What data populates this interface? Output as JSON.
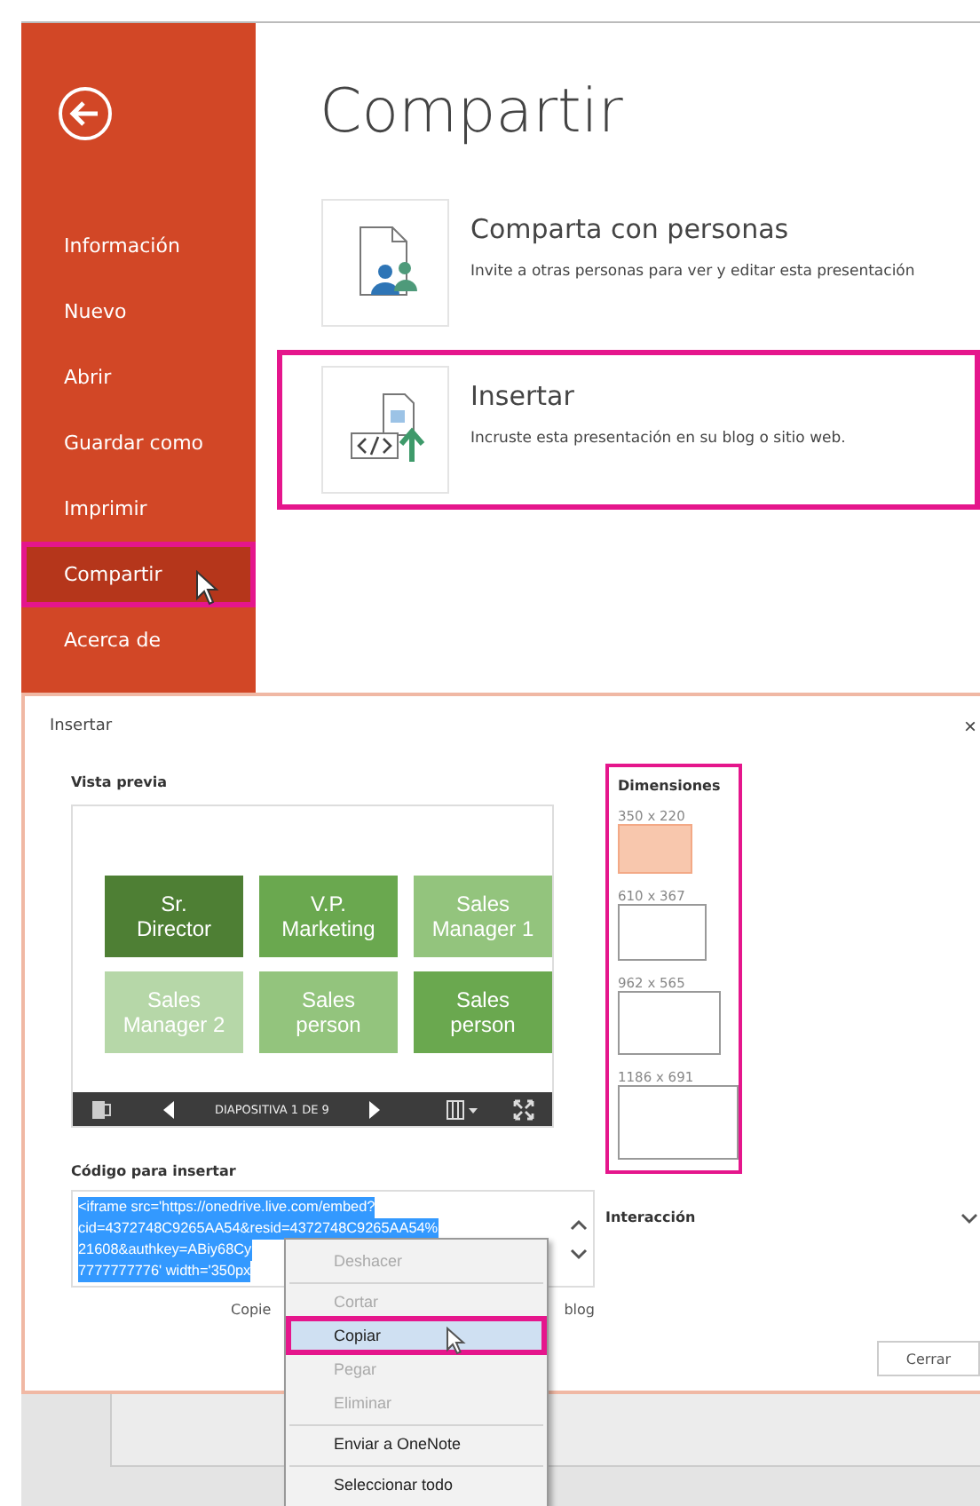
{
  "backstage": {
    "nav": [
      {
        "label": "Información",
        "selected": false,
        "highlighted": false
      },
      {
        "label": "Nuevo",
        "selected": false,
        "highlighted": false
      },
      {
        "label": "Abrir",
        "selected": false,
        "highlighted": false
      },
      {
        "label": "Guardar como",
        "selected": false,
        "highlighted": false
      },
      {
        "label": "Imprimir",
        "selected": false,
        "highlighted": false
      },
      {
        "label": "Compartir",
        "selected": true,
        "highlighted": true
      },
      {
        "label": "Acerca de",
        "selected": false,
        "highlighted": false
      }
    ],
    "title": "Compartir",
    "options": [
      {
        "kind": "people",
        "title": "Comparta con personas",
        "description": "Invite a otras personas para ver y editar esta presentación",
        "highlighted": false
      },
      {
        "kind": "embed",
        "title": "Insertar",
        "description": "Incruste esta presentación en su blog o sitio web.",
        "highlighted": true
      }
    ]
  },
  "dialog": {
    "title": "Insertar",
    "close": "×",
    "preview": {
      "label": "Vista previa",
      "tiles": [
        {
          "text": "Sr. Director",
          "color": "#4e7f34"
        },
        {
          "text": "V.P. Marketing",
          "color": "#6aa84f"
        },
        {
          "text": "Sales Manager 1",
          "color": "#93c47d"
        },
        {
          "text": "Sales Manager 2",
          "color": "#b6d7a8"
        },
        {
          "text": "Sales person",
          "color": "#93c47d"
        },
        {
          "text": "Sales person",
          "color": "#6aa84f"
        }
      ],
      "slide_counter": "DIAPOSITIVA 1 DE 9"
    },
    "dimensions": {
      "label": "Dimensiones",
      "highlighted": true,
      "options": [
        {
          "label": "350 x 220",
          "selected": true
        },
        {
          "label": "610 x 367",
          "selected": false
        },
        {
          "label": "962 x 565",
          "selected": false
        },
        {
          "label": "1186 x 691",
          "selected": false
        }
      ]
    },
    "interaction": {
      "label": "Interacción",
      "expanded": false
    },
    "embed_code": {
      "label": "Código para insertar",
      "lines": [
        "<iframe src='https://onedrive.live.com/embed?",
        "cid=4372748C9265AA54&resid=4372748C9265AA54%",
        "21608&authkey=ABiy68Cy",
        "7777777776' width='350px"
      ]
    },
    "hint_start": "Copie",
    "hint_end": "blog",
    "button": "Cerrar"
  },
  "context_menu": [
    {
      "label": "Deshacer",
      "disabled": true,
      "selected": false,
      "separator_after": true
    },
    {
      "label": "Cortar",
      "disabled": true,
      "selected": false,
      "separator_after": false
    },
    {
      "label": "Copiar",
      "disabled": false,
      "selected": true,
      "separator_after": false
    },
    {
      "label": "Pegar",
      "disabled": true,
      "selected": false,
      "separator_after": false
    },
    {
      "label": "Eliminar",
      "disabled": true,
      "selected": false,
      "separator_after": true
    },
    {
      "label": "Enviar a OneNote",
      "disabled": false,
      "selected": false,
      "separator_after": true
    },
    {
      "label": "Seleccionar todo",
      "disabled": false,
      "selected": false,
      "separator_after": false
    }
  ]
}
